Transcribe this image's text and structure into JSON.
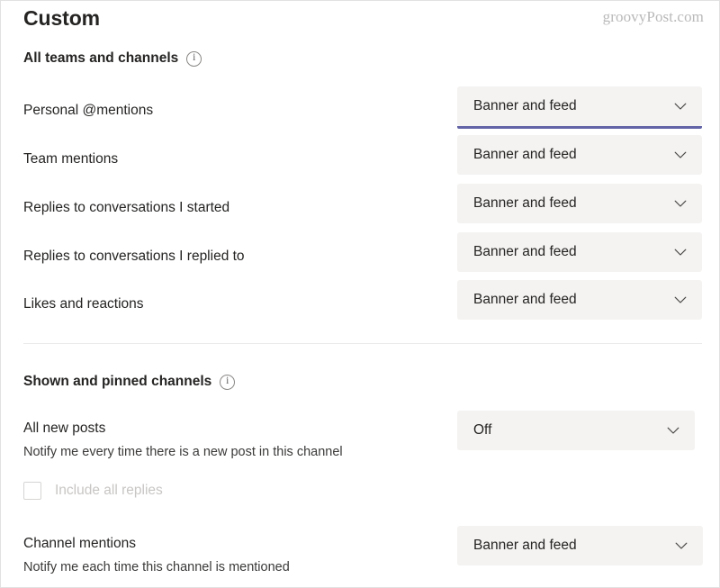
{
  "watermark": "groovyPost.com",
  "page": {
    "title": "Custom"
  },
  "colors": {
    "accent": "#6264A7",
    "dropdown_bg": "#F4F3F2",
    "text": "#252423",
    "muted_text": "#C8C6C4",
    "divider": "#EBEAEA"
  },
  "sections": [
    {
      "heading": "All teams and channels",
      "info_icon": "info-circle-icon",
      "rows": [
        {
          "label": "Personal @mentions",
          "value": "Banner and feed",
          "focused": true
        },
        {
          "label": "Team mentions",
          "value": "Banner and feed",
          "focused": false
        },
        {
          "label": "Replies to conversations I started",
          "value": "Banner and feed",
          "focused": false
        },
        {
          "label": "Replies to conversations I replied to",
          "value": "Banner and feed",
          "focused": false
        },
        {
          "label": "Likes and reactions",
          "value": "Banner and feed",
          "focused": false
        }
      ]
    },
    {
      "heading": "Shown and pinned channels",
      "info_icon": "info-circle-icon",
      "rows": [
        {
          "label": "All new posts",
          "description": "Notify me every time there is a new post in this channel",
          "value": "Off",
          "focused": false
        },
        {
          "label": "Channel mentions",
          "description": "Notify me each time this channel is mentioned",
          "value": "Banner and feed",
          "focused": false
        }
      ],
      "checkbox": {
        "label": "Include all replies",
        "checked": false,
        "disabled": true
      }
    }
  ],
  "dropdown_chevron_icon": "chevron-down-icon"
}
